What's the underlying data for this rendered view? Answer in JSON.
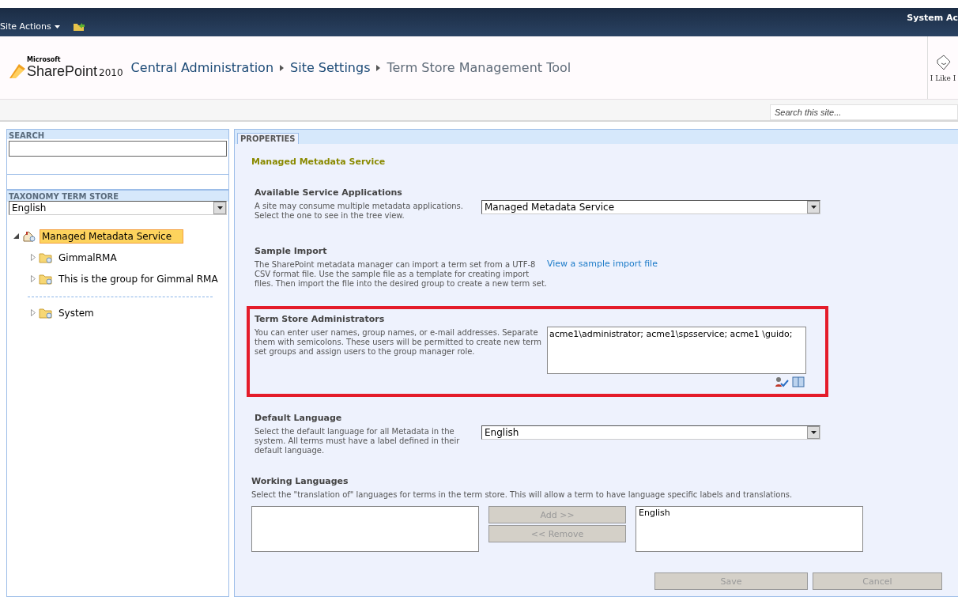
{
  "top_bar": {
    "site_actions": "Site Actions",
    "user": "System Ac"
  },
  "header": {
    "brand_small": "Microsoft",
    "brand": "SharePoint",
    "version": "2010",
    "breadcrumb": [
      {
        "label": "Central Administration",
        "current": false
      },
      {
        "label": "Site Settings",
        "current": false
      },
      {
        "label": "Term Store Management Tool",
        "current": true
      }
    ],
    "like_label": "I Like I"
  },
  "site_search": {
    "placeholder": "Search this site..."
  },
  "left_panel": {
    "search_title": "SEARCH",
    "taxonomy_title": "TAXONOMY TERM STORE",
    "language": "English",
    "tree": [
      {
        "label": "Managed Metadata Service",
        "expanded": true,
        "selected": true,
        "children": [
          {
            "label": "GimmalRMA",
            "expanded": false,
            "selected": false
          },
          {
            "label": "This is the group for Gimmal RMA",
            "expanded": false,
            "selected": false
          }
        ]
      }
    ],
    "system_tree": [
      {
        "label": "System",
        "expanded": false,
        "selected": false
      }
    ]
  },
  "properties": {
    "tab": "PROPERTIES",
    "title": "Managed Metadata Service",
    "sections": [
      {
        "kind": "select",
        "title": "Available Service Applications",
        "description": "A site may consume multiple metadata applications. Select the one to see in the tree view.",
        "value": "Managed Metadata Service",
        "highlighted": false
      },
      {
        "kind": "link",
        "title": "Sample Import",
        "description": "The SharePoint metadata manager can import a term set from a UTF-8 CSV format file. Use the sample file as a template for creating import files. Then import the file into the desired group to create a new term set.",
        "value": "View a sample import file",
        "highlighted": false
      },
      {
        "kind": "people",
        "title": "Term Store Administrators",
        "description": "You can enter user names, group names, or e-mail addresses. Separate them with semicolons. These users will be permitted to create new term set groups and assign users to the group manager role.",
        "value": "acme1\\administrator; acme1\\spsservice; acme1 \\guido;",
        "highlighted": true
      },
      {
        "kind": "select",
        "title": "Default Language",
        "description": "Select the default language for all Metadata in the system. All terms must have a label defined in their default language.",
        "value": "English",
        "highlighted": false
      }
    ],
    "working_languages": {
      "title": "Working Languages",
      "description": "Select the \"translation of\" languages for terms in the term store. This will allow a term to have language specific labels and translations.",
      "selected": [
        "English"
      ],
      "add_button": {
        "label": "Add >>",
        "disabled": true
      },
      "remove_button": {
        "label": "<< Remove",
        "disabled": true
      }
    },
    "save_button": {
      "label": "Save",
      "disabled": true
    },
    "cancel_button": {
      "label": "Cancel",
      "disabled": true
    }
  }
}
